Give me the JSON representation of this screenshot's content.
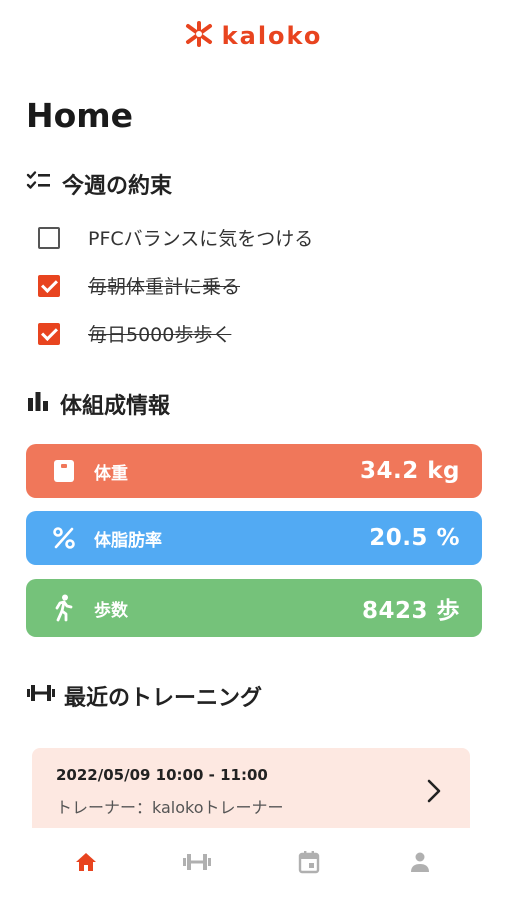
{
  "app": {
    "name": "kaloko",
    "brand_color": "#e8441f"
  },
  "page": {
    "title": "Home"
  },
  "promises": {
    "title": "今週の約束",
    "icon": "checklist-icon",
    "items": [
      {
        "label": "PFCバランスに気をつける",
        "checked": false
      },
      {
        "label": "毎朝体重計に乗る",
        "checked": true
      },
      {
        "label": "毎日5000歩歩く",
        "checked": true
      }
    ]
  },
  "body": {
    "title": "体組成情報",
    "icon": "bar-chart-icon",
    "metrics": [
      {
        "label": "体重",
        "value": "34.2 kg",
        "color": "#f0775a",
        "icon": "scale-icon"
      },
      {
        "label": "体脂肪率",
        "value": "20.5 %",
        "color": "#52aaf3",
        "icon": "percent-icon"
      },
      {
        "label": "歩数",
        "value": "8423 歩",
        "color": "#75c27a",
        "icon": "walking-icon"
      }
    ]
  },
  "training": {
    "title": "最近のトレーニング",
    "icon": "dumbbell-icon",
    "recent": {
      "datetime": "2022/05/09 10:00 - 11:00",
      "trainer_label": "トレーナー：",
      "trainer_name": "kalokoトレーナー"
    }
  },
  "nav": {
    "items": [
      {
        "name": "home",
        "active": true,
        "color": "#e8441f"
      },
      {
        "name": "training",
        "active": false,
        "color": "#b0b0b0"
      },
      {
        "name": "calendar",
        "active": false,
        "color": "#b0b0b0"
      },
      {
        "name": "profile",
        "active": false,
        "color": "#b0b0b0"
      }
    ]
  }
}
